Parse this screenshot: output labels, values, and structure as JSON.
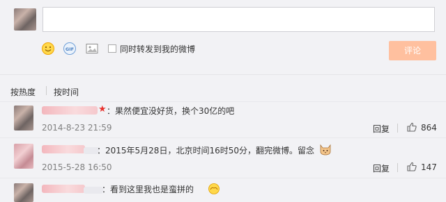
{
  "composer": {
    "input_value": "",
    "forward_label": "同时转发到我的微博",
    "submit_label": "评论",
    "icons": [
      "smiley-icon",
      "gif-icon",
      "image-icon"
    ]
  },
  "sort": {
    "hot_label": "按热度",
    "time_label": "按时间"
  },
  "comments": [
    {
      "text": "：果然便宜没好货，换个30亿的吧",
      "time": "2014-8-23 21:59",
      "reply_label": "回复",
      "likes": "864"
    },
    {
      "text": "：2015年5月28日，北京时间16时50分，翻完微博。留念",
      "time": "2015-5-28 16:50",
      "reply_label": "回复",
      "likes": "147"
    },
    {
      "text": "：看到这里我也是蛮拼的",
      "time": "",
      "reply_label": "",
      "likes": ""
    }
  ],
  "colors": {
    "background": "#f2f2f5",
    "submit_disabled": "#ffc09f",
    "star": "#e8322d",
    "time_text": "#808080"
  }
}
